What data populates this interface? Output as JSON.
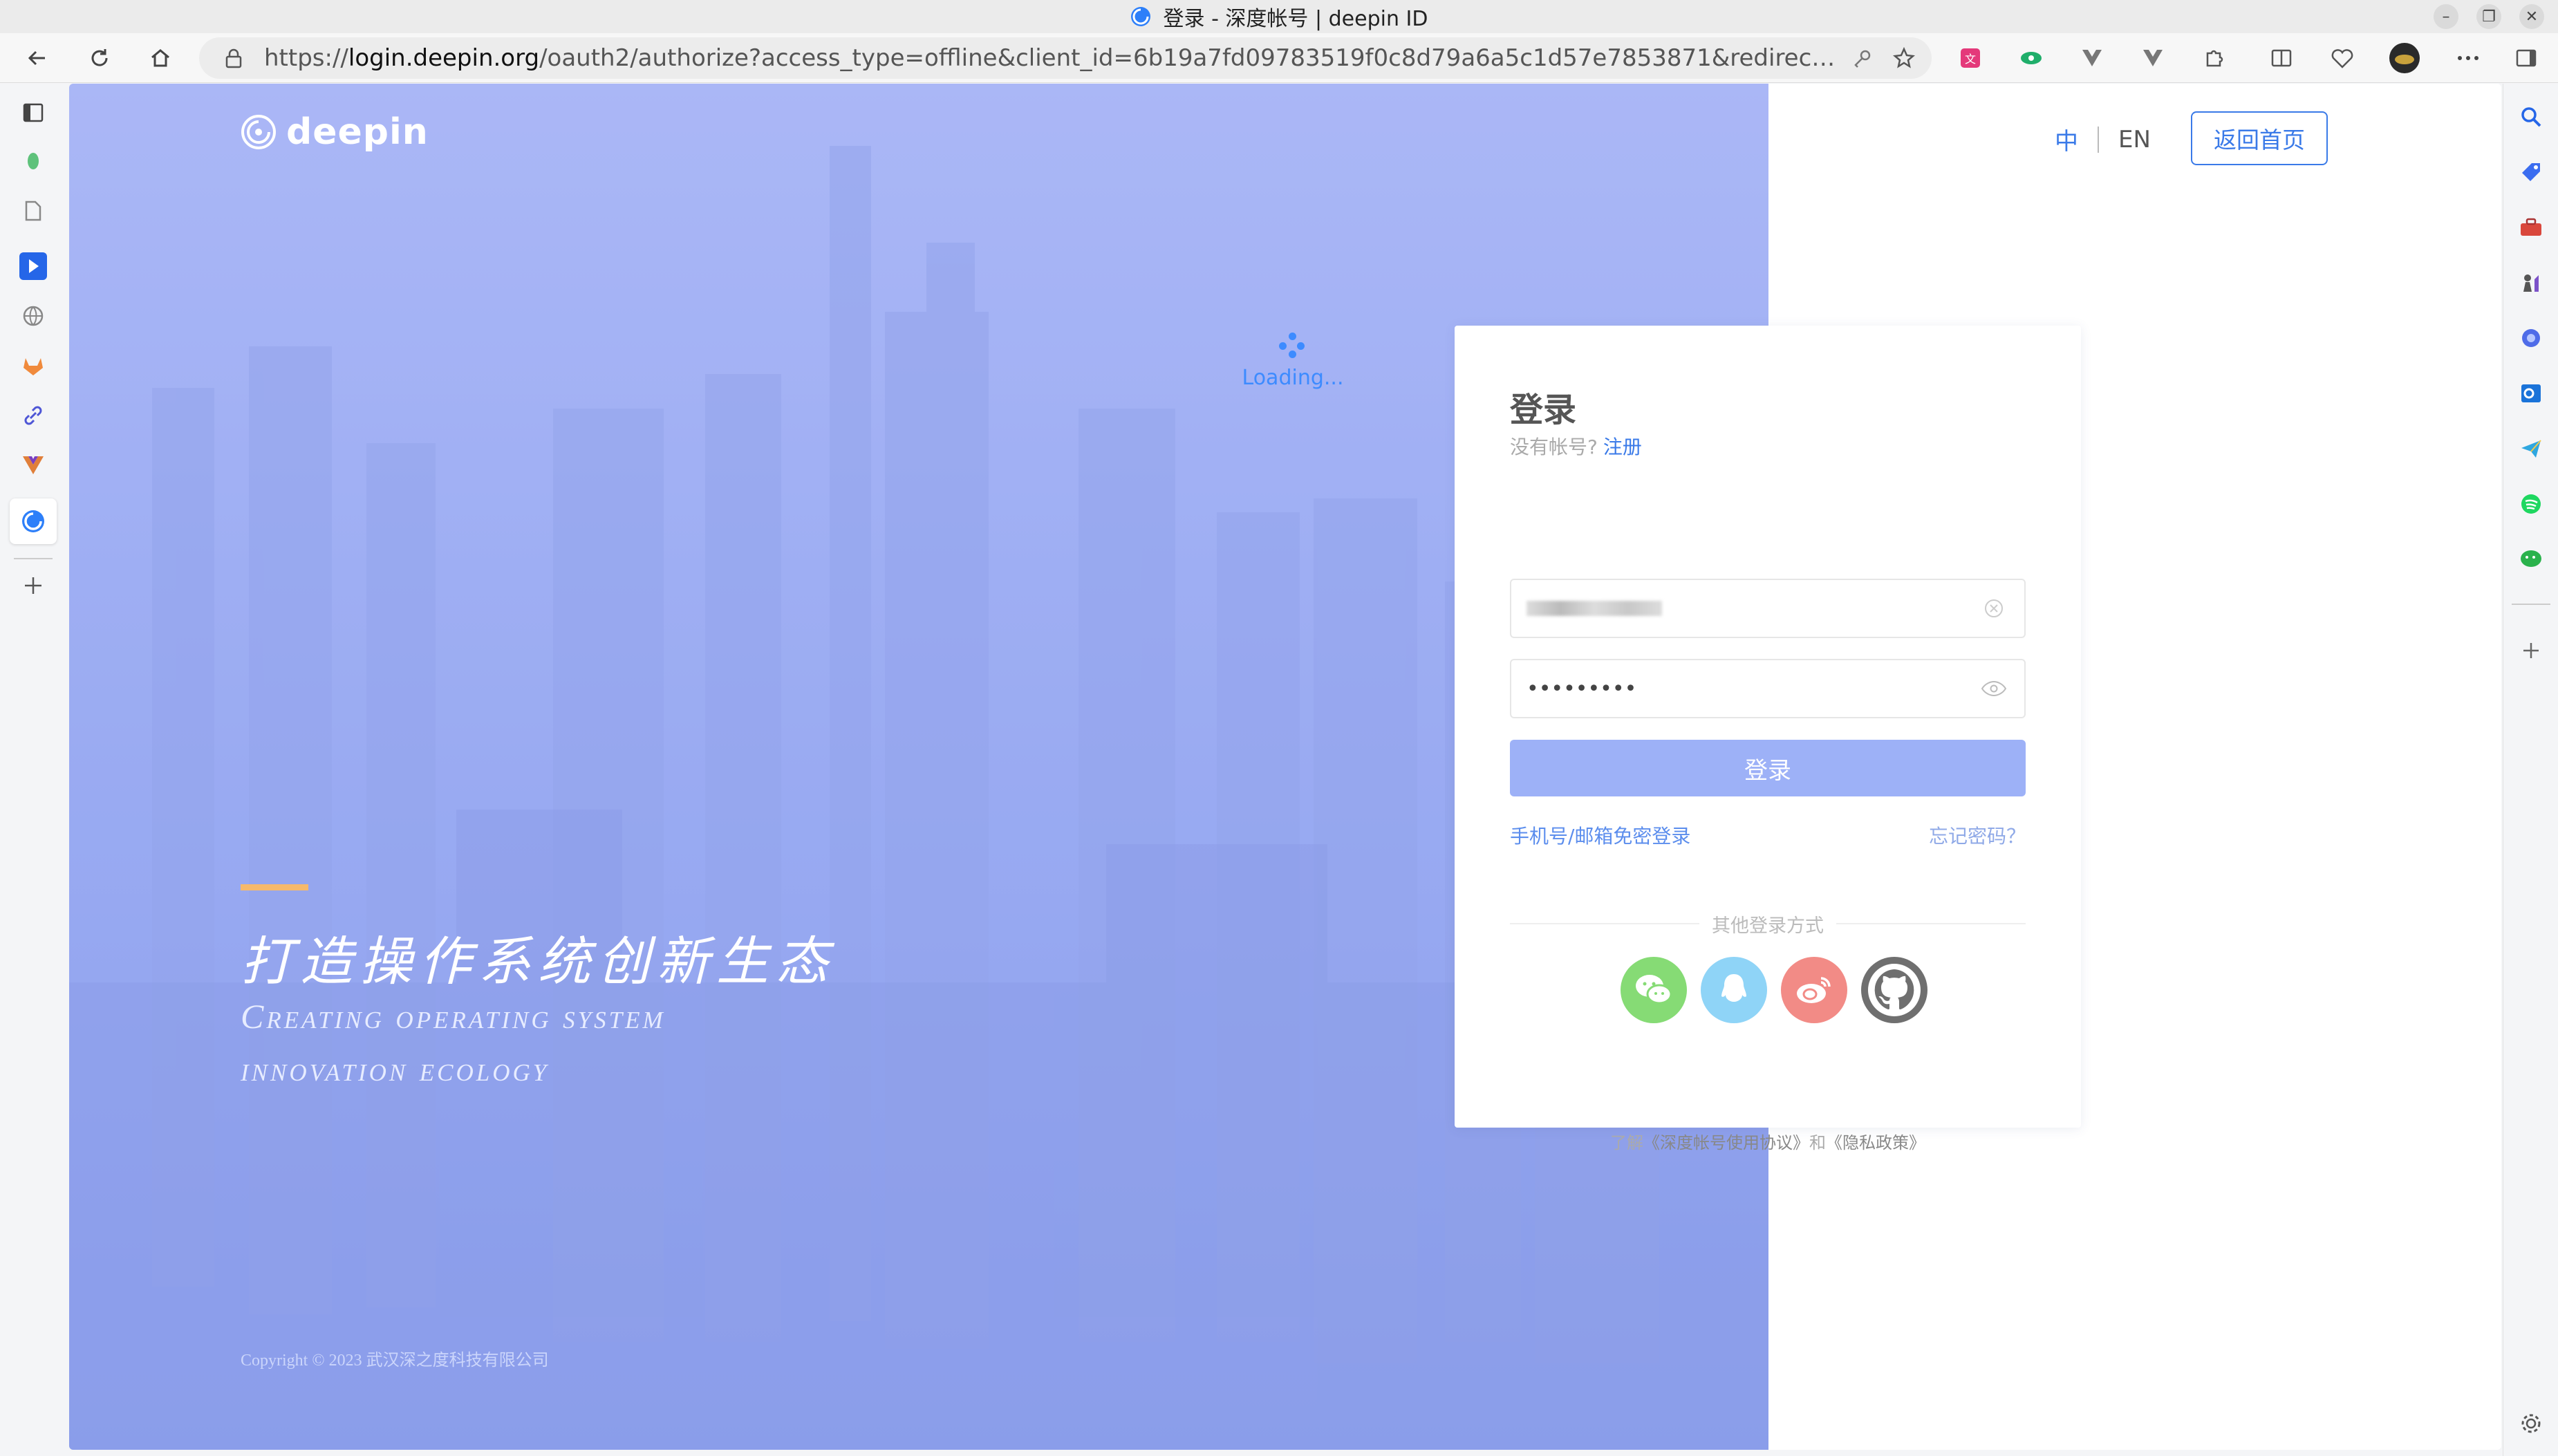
{
  "window": {
    "title": "登录 - 深度帐号 | deepin ID",
    "controls": [
      "minimize",
      "restore",
      "close"
    ]
  },
  "toolbar": {
    "url_prefix": "https://",
    "url_host": "login.deepin.org",
    "url_rest": "/oauth2/authorize?access_type=offline&client_id=6b19a7fd09783519f0c8d79a6a5c1d57e7853871&redirect_uri=https..."
  },
  "left_sidebar": {
    "icons": [
      "sidebar-toggle-icon",
      "leaf-icon",
      "document-icon",
      "play-icon",
      "globe-icon",
      "gitlab-icon",
      "link-icon",
      "vue-icon",
      "deepin-icon",
      "add-icon"
    ]
  },
  "right_sidebar": {
    "icons": [
      "search-icon",
      "tag-icon",
      "toolbox-icon",
      "chess-icon",
      "copilot-icon",
      "outlook-icon",
      "send-icon",
      "spotify-icon",
      "wechat-icon",
      "add-icon",
      "settings-icon"
    ]
  },
  "hero": {
    "logo_text": "deepin",
    "slogan_cn": "打造操作系统创新生态",
    "slogan_en_line1": "Creating operating system",
    "slogan_en_line2": "innovation ecology",
    "copyright": "Copyright © 2023 武汉深之度科技有限公司",
    "loading": "Loading..."
  },
  "header": {
    "lang_zh": "中",
    "lang_en": "EN",
    "home_button": "返回首页"
  },
  "login": {
    "title": "登录",
    "no_account": "没有帐号?",
    "signup": "注册",
    "password_value": "•••••••••",
    "submit": "登录",
    "alt_login": "手机号/邮箱免密登录",
    "forgot": "忘记密码？",
    "other_methods": "其他登录方式",
    "socials": [
      {
        "name": "wechat",
        "color": "#86db75"
      },
      {
        "name": "qq",
        "color": "#8fd4f7"
      },
      {
        "name": "weibo",
        "color": "#f28b86"
      },
      {
        "name": "github",
        "color": "#6f6f6f"
      }
    ],
    "terms_prefix": "了解",
    "terms_link1": "《深度帐号使用协议》",
    "terms_mid": "和",
    "terms_link2": "《隐私政策》"
  },
  "colors": {
    "accent": "#3a7ae8",
    "hero_top": "#a9b6f6",
    "hero_bottom": "#7f96ea",
    "submit": "#9db1f7",
    "slogan_bar": "#f6b96b"
  }
}
